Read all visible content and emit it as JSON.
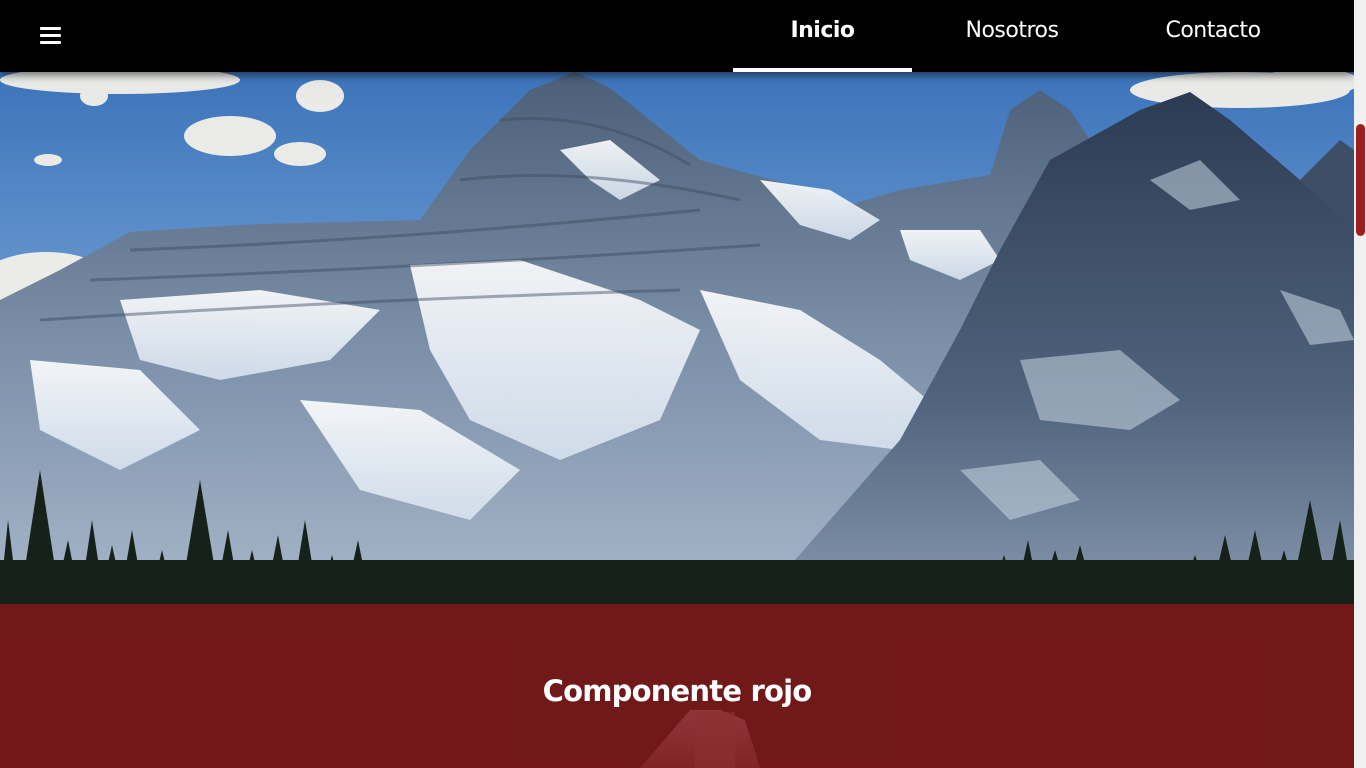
{
  "nav": {
    "menu_icon": "hamburger-menu-icon",
    "items": [
      {
        "label": "Inicio",
        "active": true
      },
      {
        "label": "Nosotros",
        "active": false
      },
      {
        "label": "Contacto",
        "active": false
      }
    ]
  },
  "hero": {
    "image": "mountain-landscape"
  },
  "red_component": {
    "title": "Componente rojo",
    "color": "#8c161a"
  },
  "colors": {
    "navbar_bg": "#000000",
    "nav_text": "#ffffff",
    "scroll_thumb": "#9e1f20"
  }
}
